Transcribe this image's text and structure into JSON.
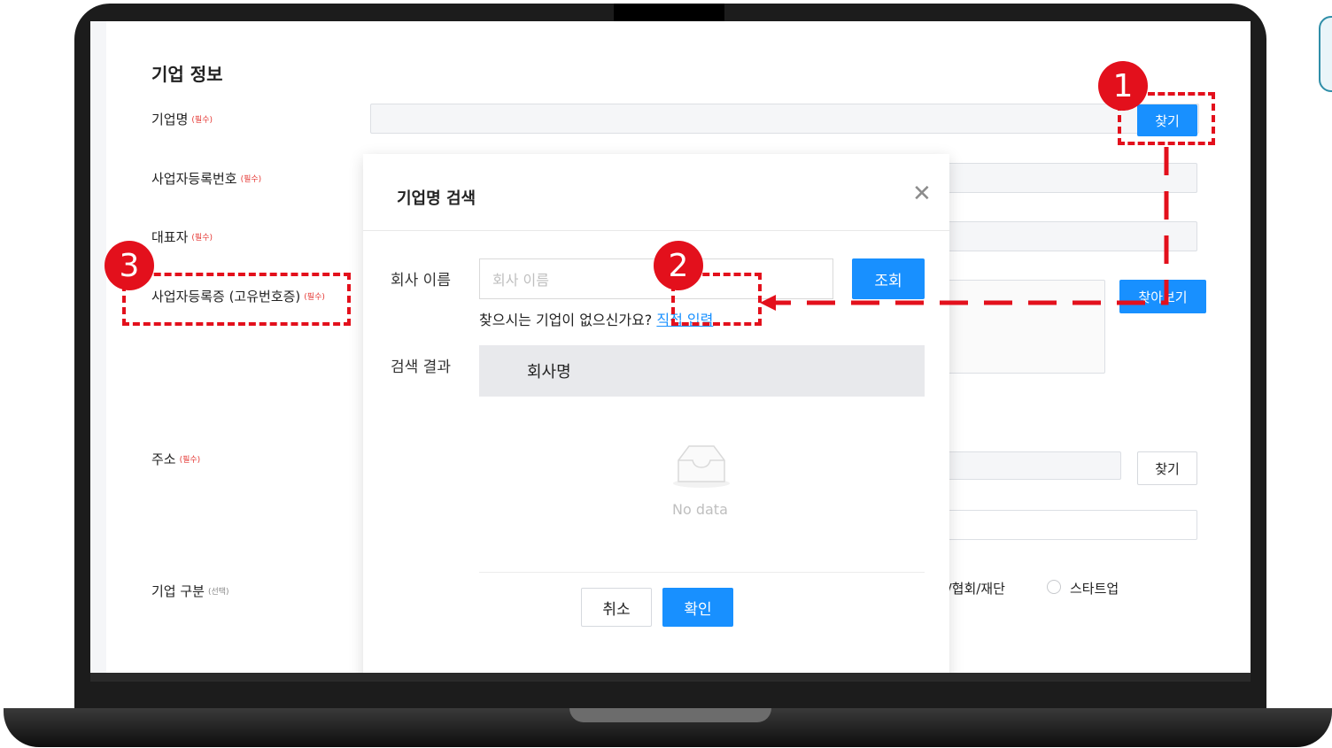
{
  "form": {
    "section_title": "기업 정보",
    "required_tag": "(필수)",
    "optional_tag": "(선택)",
    "fields": {
      "company_name": "기업명",
      "business_number": "사업자등록번호",
      "representative": "대표자",
      "business_certificate": "사업자등록증 (고유번호증)",
      "address": "주소",
      "company_type": "기업 구분"
    },
    "find_button": "찾기",
    "browse_button": "찾아보기",
    "address_find_button": "찾기",
    "company_type_options": {
      "partial_option": "단체/협회/재단",
      "startup": "스타트업"
    }
  },
  "modal": {
    "title": "기업명 검색",
    "company_name_label": "회사 이름",
    "company_name_placeholder": "회사 이름",
    "search_button": "조회",
    "hint_text": "찾으시는 기업이 없으신가요?",
    "direct_input_link": "직접 입력",
    "result_label": "검색 결과",
    "table_header": "회사명",
    "empty_text": "No data",
    "cancel_button": "취소",
    "confirm_button": "확인"
  },
  "annotations": {
    "step1": "1",
    "step2": "2",
    "step3": "3",
    "color": "#e3101c"
  },
  "colors": {
    "primary": "#1890ff",
    "annotation": "#e3101c"
  }
}
